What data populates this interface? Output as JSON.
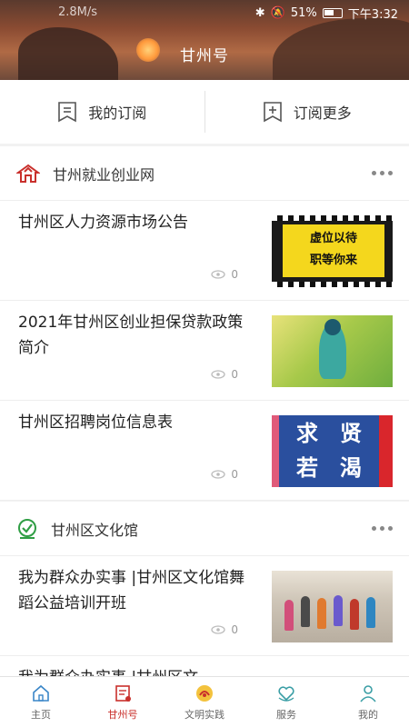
{
  "status_bar": {
    "network_speed": "2.8M/s",
    "battery": "51%",
    "time": "下午3:32"
  },
  "header": {
    "title": "甘州号"
  },
  "subscription": {
    "my_label": "我的订阅",
    "more_label": "订阅更多"
  },
  "sections": [
    {
      "name": "甘州就业创业网",
      "articles": [
        {
          "title": "甘州区人力资源市场公告",
          "views": "0",
          "thumb_text": [
            "虚位以待",
            "职等你来"
          ]
        },
        {
          "title": "2021年甘州区创业担保贷款政策简介",
          "views": "0"
        },
        {
          "title": "甘州区招聘岗位信息表",
          "views": "0",
          "thumb_text": [
            "求",
            "贤",
            "若",
            "渴"
          ]
        }
      ]
    },
    {
      "name": "甘州区文化馆",
      "articles": [
        {
          "title": "我为群众办实事 |甘州区文化馆舞蹈公益培训开班",
          "views": "0"
        },
        {
          "title": "我为群众办实事 |甘州区文",
          "views": ""
        }
      ]
    }
  ],
  "tabs": [
    {
      "label": "主页",
      "icon": "home-icon"
    },
    {
      "label": "甘州号",
      "icon": "news-icon",
      "active": true
    },
    {
      "label": "文明实践",
      "icon": "emblem-icon"
    },
    {
      "label": "服务",
      "icon": "heart-hands-icon"
    },
    {
      "label": "我的",
      "icon": "user-icon"
    }
  ],
  "colors": {
    "accent": "#c9302c",
    "header_bg": "#8a4b32"
  }
}
